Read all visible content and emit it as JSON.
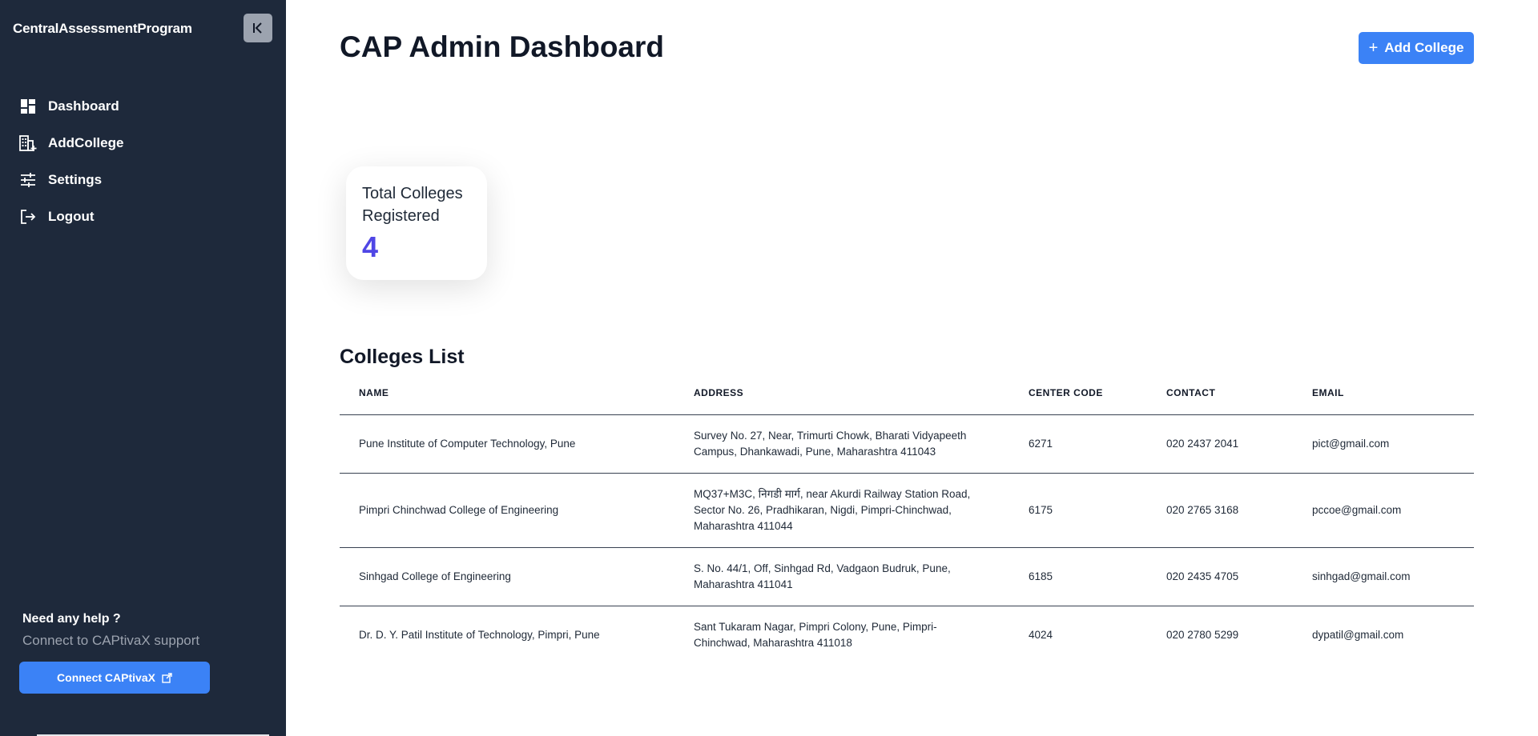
{
  "sidebar": {
    "brand": "CentralAssessmentProgram",
    "nav": [
      {
        "label": "Dashboard",
        "icon": "dashboard-icon"
      },
      {
        "label": "AddCollege",
        "icon": "add-building-icon"
      },
      {
        "label": "Settings",
        "icon": "sliders-icon"
      },
      {
        "label": "Logout",
        "icon": "logout-icon"
      }
    ],
    "help_title": "Need any help ?",
    "help_subtitle": "Connect to CAPtivaX support",
    "connect_label": "Connect CAPtivaX"
  },
  "header": {
    "title": "CAP Admin Dashboard",
    "add_button_label": "Add College"
  },
  "stats": {
    "total_label": "Total Colleges Registered",
    "total_value": "4"
  },
  "colleges": {
    "section_title": "Colleges List",
    "columns": [
      "NAME",
      "ADDRESS",
      "CENTER CODE",
      "CONTACT",
      "EMAIL"
    ],
    "rows": [
      {
        "name": "Pune Institute of Computer Technology, Pune",
        "address": "Survey No. 27, Near, Trimurti Chowk, Bharati Vidyapeeth Campus, Dhankawadi, Pune, Maharashtra 411043",
        "code": "6271",
        "contact": "020 2437 2041",
        "email": "pict@gmail.com"
      },
      {
        "name": "Pimpri Chinchwad College of Engineering",
        "address": "MQ37+M3C, निगडी मार्ग, near Akurdi Railway Station Road, Sector No. 26, Pradhikaran, Nigdi, Pimpri-Chinchwad, Maharashtra 411044",
        "code": "6175",
        "contact": "020 2765 3168",
        "email": "pccoe@gmail.com"
      },
      {
        "name": "Sinhgad College of Engineering",
        "address": "S. No. 44/1, Off, Sinhgad Rd, Vadgaon Budruk, Pune, Maharashtra 411041",
        "code": "6185",
        "contact": "020 2435 4705",
        "email": "sinhgad@gmail.com"
      },
      {
        "name": "Dr. D. Y. Patil Institute of Technology, Pimpri, Pune",
        "address": "Sant Tukaram Nagar, Pimpri Colony, Pune, Pimpri-Chinchwad, Maharashtra 411018",
        "code": "4024",
        "contact": "020 2780 5299",
        "email": "dypatil@gmail.com"
      }
    ]
  },
  "colors": {
    "sidebar_bg": "#1e293b",
    "accent": "#3b82f6",
    "stat_value": "#4f46e5"
  }
}
